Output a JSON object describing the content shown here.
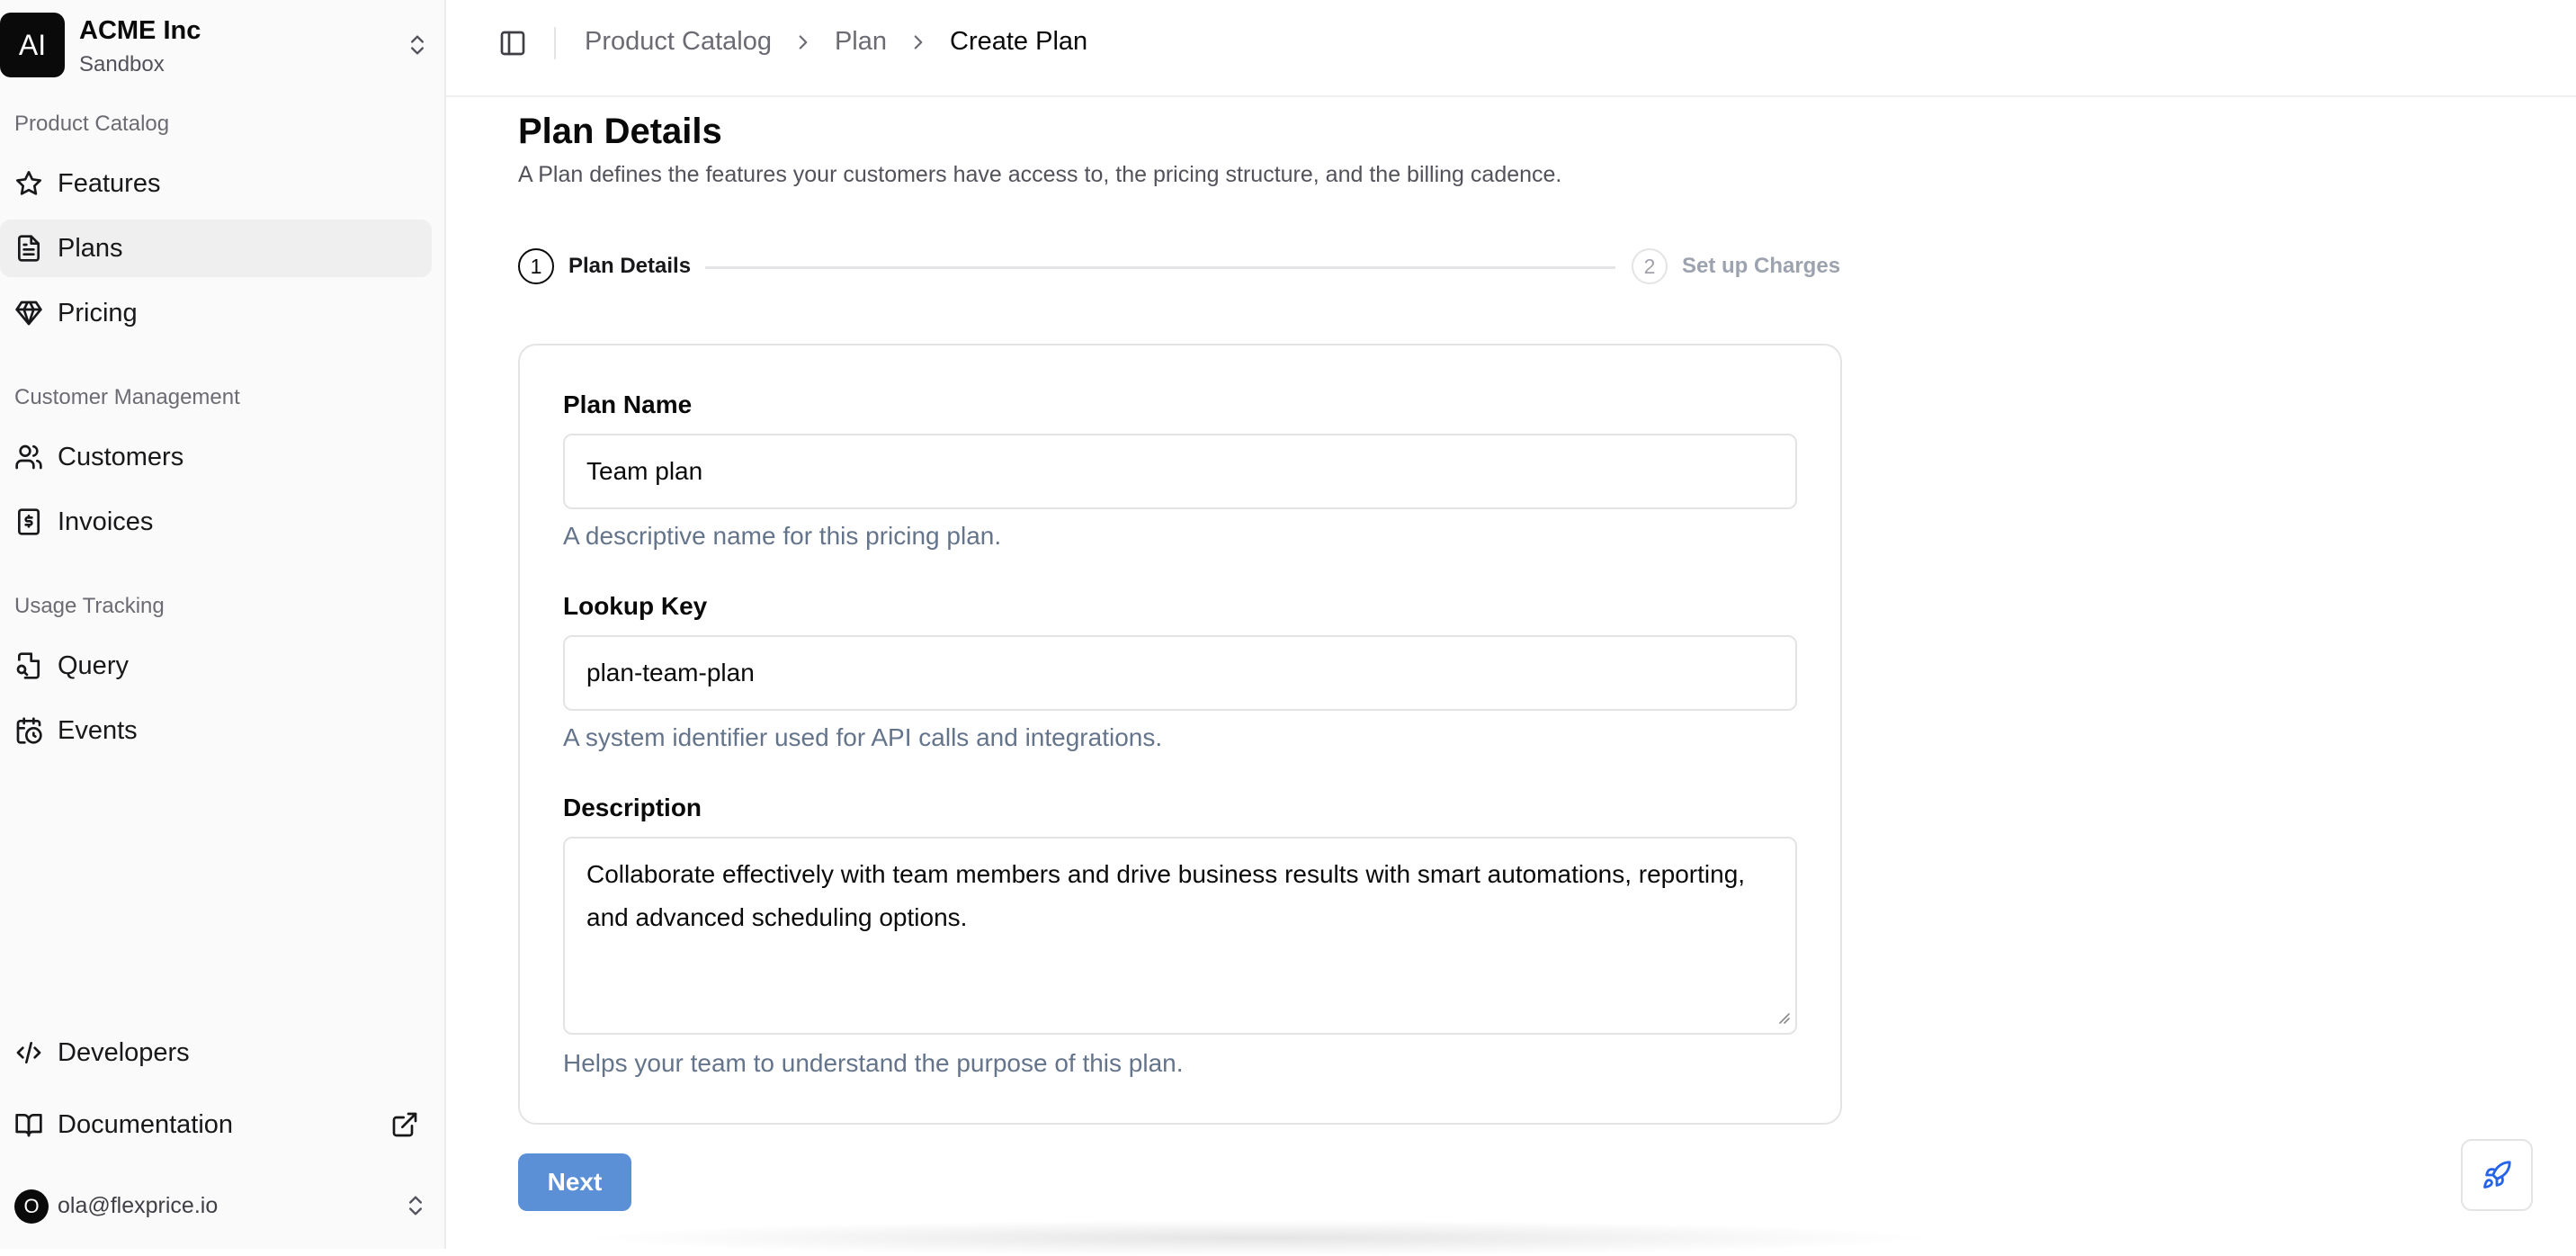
{
  "org": {
    "logo_text": "AI",
    "name": "ACME Inc",
    "environment": "Sandbox"
  },
  "sidebar": {
    "groups": [
      {
        "label": "Product Catalog",
        "items": [
          {
            "label": "Features",
            "icon": "star-icon"
          },
          {
            "label": "Plans",
            "icon": "document-icon"
          },
          {
            "label": "Pricing",
            "icon": "gem-icon"
          }
        ]
      },
      {
        "label": "Customer Management",
        "items": [
          {
            "label": "Customers",
            "icon": "users-icon"
          },
          {
            "label": "Invoices",
            "icon": "receipt-icon"
          }
        ]
      },
      {
        "label": "Usage Tracking",
        "items": [
          {
            "label": "Query",
            "icon": "file-search-icon"
          },
          {
            "label": "Events",
            "icon": "calendar-clock-icon"
          }
        ]
      }
    ],
    "active_item": "Plans",
    "footer": [
      {
        "label": "Developers",
        "icon": "code-icon"
      },
      {
        "label": "Documentation",
        "icon": "book-icon"
      }
    ]
  },
  "user": {
    "avatar_text": "O",
    "email": "ola@flexprice.io"
  },
  "breadcrumb": [
    "Product Catalog",
    "Plan",
    "Create Plan"
  ],
  "page": {
    "title": "Plan Details",
    "description": "A Plan defines the features your customers have access to, the pricing structure, and the billing cadence."
  },
  "stepper": {
    "steps": [
      {
        "number": "1",
        "label": "Plan Details",
        "state": "active"
      },
      {
        "number": "2",
        "label": "Set up Charges",
        "state": "inactive"
      }
    ]
  },
  "form": {
    "plan_name": {
      "label": "Plan Name",
      "value": "Team plan",
      "help": "A descriptive name for this pricing plan."
    },
    "lookup_key": {
      "label": "Lookup Key",
      "value": "plan-team-plan",
      "help": "A system identifier used for API calls and integrations."
    },
    "description": {
      "label": "Description",
      "value": "Collaborate effectively with team members and drive business results with smart automations, reporting, and advanced scheduling options.",
      "help": "Helps your team to understand the purpose of this plan."
    }
  },
  "actions": {
    "next_label": "Next"
  },
  "colors": {
    "primary_button": "#5b8fd6",
    "fab_icon": "#2563eb",
    "active_nav_bg": "#efefef"
  }
}
